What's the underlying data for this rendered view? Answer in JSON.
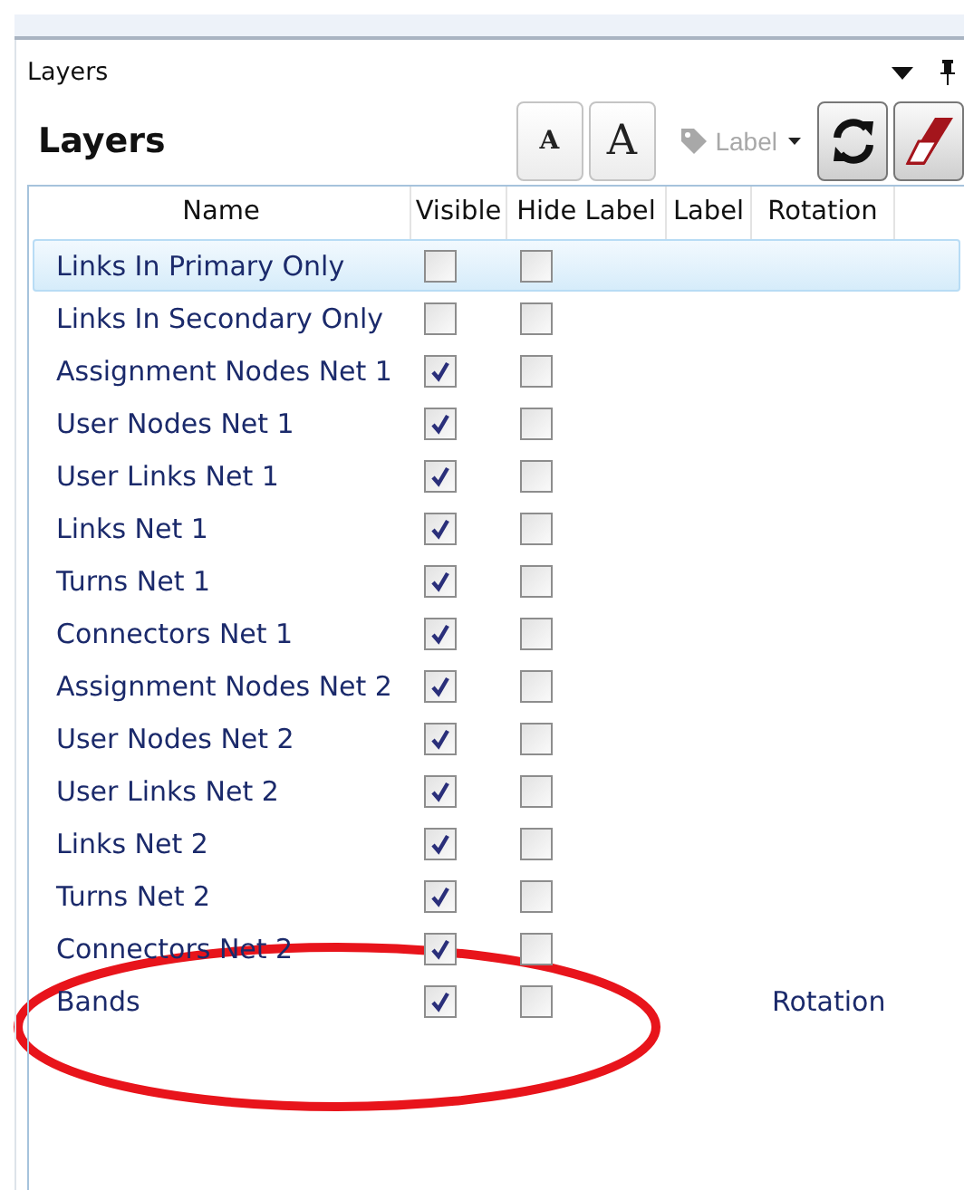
{
  "pane": {
    "title": "Layers"
  },
  "panel": {
    "heading": "Layers"
  },
  "toolbar": {
    "small_font_button": "A",
    "large_font_button": "A",
    "label_button": {
      "label": "Label",
      "disabled": true
    }
  },
  "table": {
    "columns": [
      "Name",
      "Visible",
      "Hide Label",
      "Label",
      "Rotation"
    ],
    "rows": [
      {
        "name": "Links In Primary Only",
        "visible": false,
        "hide_label": false,
        "selected": true
      },
      {
        "name": "Links In Secondary Only",
        "visible": false,
        "hide_label": false,
        "selected": false
      },
      {
        "name": "Assignment Nodes Net 1",
        "visible": true,
        "hide_label": false,
        "selected": false
      },
      {
        "name": "User Nodes Net 1",
        "visible": true,
        "hide_label": false,
        "selected": false
      },
      {
        "name": "User Links Net 1",
        "visible": true,
        "hide_label": false,
        "selected": false
      },
      {
        "name": "Links Net 1",
        "visible": true,
        "hide_label": false,
        "selected": false
      },
      {
        "name": "Turns Net 1",
        "visible": true,
        "hide_label": false,
        "selected": false
      },
      {
        "name": "Connectors Net 1",
        "visible": true,
        "hide_label": false,
        "selected": false
      },
      {
        "name": "Assignment Nodes Net 2",
        "visible": true,
        "hide_label": false,
        "selected": false
      },
      {
        "name": "User Nodes Net 2",
        "visible": true,
        "hide_label": false,
        "selected": false
      },
      {
        "name": "User Links Net 2",
        "visible": true,
        "hide_label": false,
        "selected": false
      },
      {
        "name": "Links Net 2",
        "visible": true,
        "hide_label": false,
        "selected": false
      },
      {
        "name": "Turns Net 2",
        "visible": true,
        "hide_label": false,
        "selected": false
      },
      {
        "name": "Connectors Net 2",
        "visible": true,
        "hide_label": false,
        "selected": false
      },
      {
        "name": "Bands",
        "visible": true,
        "hide_label": false,
        "selected": false,
        "rotation": "Rotation"
      }
    ]
  }
}
